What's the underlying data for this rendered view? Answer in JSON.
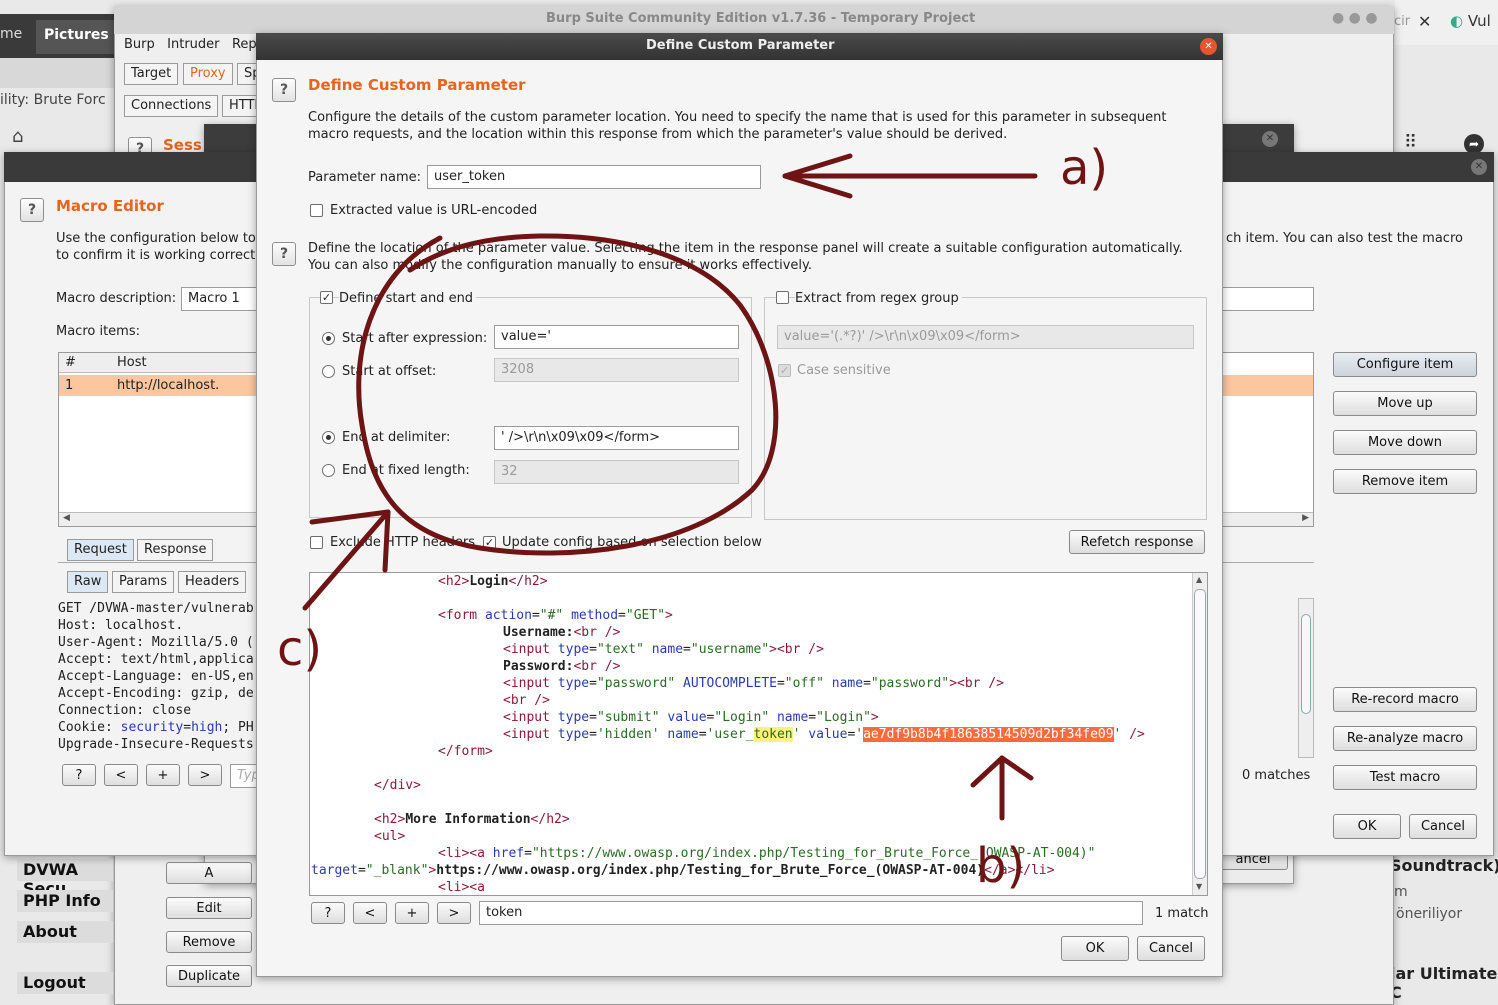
{
  "desktop": {
    "tab_home": "me",
    "tab_pictures": "Pictures",
    "browser_title": "ility: Brute Forc",
    "right_tab": "Vul",
    "right_cir": "cir",
    "right_text_1": "Soundtrack) |",
    "right_text_2": "m",
    "right_text_3": "öneriliyor",
    "right_text_4": "lar Ultimate C"
  },
  "burp": {
    "title": "Burp Suite Community Edition v1.7.36 - Temporary Project",
    "menu": [
      "Burp",
      "Intruder",
      "Repe"
    ],
    "tabs": [
      "Target",
      "Proxy",
      "Sp"
    ],
    "subtabs": [
      "Connections",
      "HTTP"
    ],
    "sess": "Sess"
  },
  "macro_editor": {
    "title": "Macro Editor",
    "desc1": "Use the configuration below to",
    "desc2": "to confirm it is working correct",
    "desc_right": "ch item. You can also test the macro",
    "desc_label": "Macro description:",
    "desc_value": "Macro 1",
    "items_label": "Macro items:",
    "col_num": "#",
    "col_host": "Host",
    "row_num": "1",
    "row_host": "http://localhost.",
    "req_tabs": [
      "Request",
      "Response"
    ],
    "raw_tabs": [
      "Raw",
      "Params",
      "Headers"
    ],
    "request_lines": [
      "GET /DVWA-master/vulnerab",
      "Host: localhost.",
      "User-Agent: Mozilla/5.0 (",
      "Accept: text/html,applica",
      "Accept-Language: en-US,en",
      "Accept-Encoding: gzip, de",
      "Connection: close"
    ],
    "cookie_key": "Cookie: ",
    "cookie_sec": "security",
    "cookie_eq": "=",
    "cookie_high": "high",
    "cookie_rest": "; PH",
    "upgrade": "Upgrade-Insecure-Requests",
    "nav_q": "?",
    "nav_prev": "<",
    "nav_plus": "+",
    "nav_next": ">",
    "search_ph": "Typ",
    "buttons": {
      "configure": "Configure item",
      "move_up": "Move up",
      "move_down": "Move down",
      "remove": "Remove item",
      "rerecord": "Re-record macro",
      "reanalyze": "Re-analyze macro",
      "test": "Test macro",
      "ok": "OK",
      "cancel": "Cancel"
    },
    "matches": "0 matches"
  },
  "session": {
    "add": "A",
    "edit": "Edit",
    "remove": "Remove",
    "duplicate": "Duplicate",
    "cancel": "ancel"
  },
  "dvwa": {
    "security": "DVWA Secu",
    "phpinfo": "PHP Info",
    "about": "About",
    "logout": "Logout"
  },
  "dialog": {
    "window_title": "Define Custom Parameter",
    "heading": "Define Custom Parameter",
    "desc1": "Configure the details of the custom parameter location. You need to specify the name that is used for this parameter in subsequent",
    "desc2": "macro requests, and the location within this response from which the parameter's value should be derived.",
    "param_label": "Parameter name:",
    "param_value": "user_token",
    "urlenc_label": "Extracted value is URL-encoded",
    "loc1": "Define the location of the parameter value. Selecting the item in the response panel will create a suitable configuration automatically.",
    "loc2": "You can also modify the configuration manually to ensure it works effectively.",
    "define_start_end": "Define start and end",
    "start_after": "Start after expression:",
    "start_after_value": "value='",
    "start_offset": "Start at offset:",
    "start_offset_value": "3208",
    "end_delim": "End at delimiter:",
    "end_delim_value": "' />\\r\\n\\x09\\x09</form>",
    "end_fixed": "End at fixed length:",
    "end_fixed_value": "32",
    "regex_label": "Extract from regex group",
    "regex_value": "value='(.*?)' />\\r\\n\\x09\\x09</form>",
    "case_sensitive": "Case sensitive",
    "exclude_headers": "Exclude HTTP headers",
    "update_config": "Update config based on selection below",
    "refetch": "Refetch response",
    "search_value": "token",
    "match_count": "1 match",
    "ok": "OK",
    "cancel": "Cancel",
    "nav_q": "?",
    "nav_prev": "<",
    "nav_plus": "+",
    "nav_next": ">",
    "token_value": "ae7df9b8b4f18638514509d2bf34fe09"
  },
  "response": {
    "h2_login": "Login",
    "h2_more": "More Information",
    "form_action": "#",
    "form_method": "GET",
    "username": "Username:",
    "password": "Password:",
    "login_value": "Login",
    "owasp_url": "https://www.owasp.org/index.php/Testing_for_Brute_Force_(OWASP-AT-004)",
    "target": "_blank"
  },
  "annotations": {
    "a": "a)",
    "b": "b)",
    "c": "c)"
  },
  "colors": {
    "accent": "#e8641c",
    "annotation": "#6e1414",
    "highlight": "#ff6a3d",
    "selected_row": "#fcc79e"
  }
}
